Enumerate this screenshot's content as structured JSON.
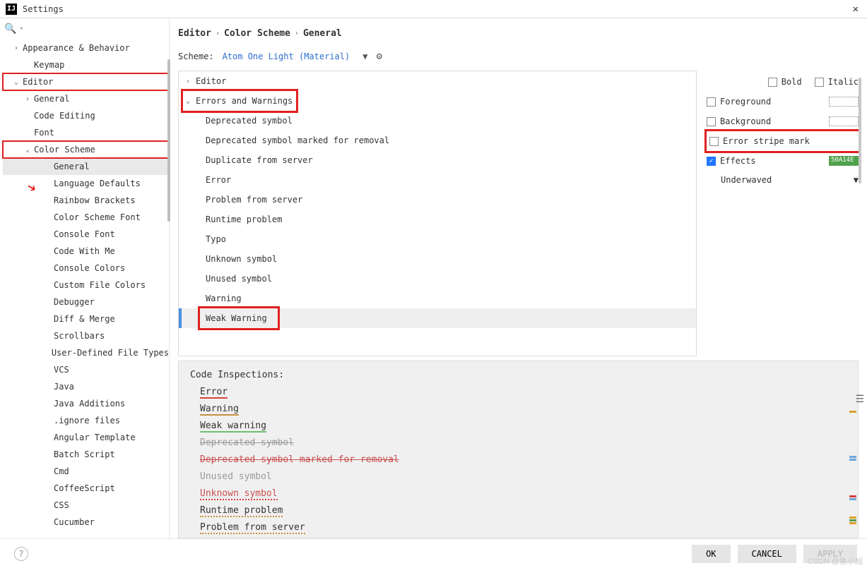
{
  "window": {
    "title": "Settings"
  },
  "sidebar": {
    "items": [
      {
        "label": "Appearance & Behavior",
        "level": 1,
        "arrow": ">"
      },
      {
        "label": "Keymap",
        "level": 2,
        "arrow": ""
      },
      {
        "label": "Editor",
        "level": 1,
        "arrow": "v",
        "redbox": true
      },
      {
        "label": "General",
        "level": 2,
        "arrow": ">"
      },
      {
        "label": "Code Editing",
        "level": 2,
        "arrow": ""
      },
      {
        "label": "Font",
        "level": 2,
        "arrow": ""
      },
      {
        "label": "Color Scheme",
        "level": 2,
        "arrow": "v",
        "redbox": true
      },
      {
        "label": "General",
        "level": 4,
        "arrow": "",
        "selected": true
      },
      {
        "label": "Language Defaults",
        "level": 4,
        "arrow": ""
      },
      {
        "label": "Rainbow Brackets",
        "level": 4,
        "arrow": ""
      },
      {
        "label": "Color Scheme Font",
        "level": 4,
        "arrow": ""
      },
      {
        "label": "Console Font",
        "level": 4,
        "arrow": ""
      },
      {
        "label": "Code With Me",
        "level": 4,
        "arrow": ""
      },
      {
        "label": "Console Colors",
        "level": 4,
        "arrow": ""
      },
      {
        "label": "Custom File Colors",
        "level": 4,
        "arrow": ""
      },
      {
        "label": "Debugger",
        "level": 4,
        "arrow": ""
      },
      {
        "label": "Diff & Merge",
        "level": 4,
        "arrow": ""
      },
      {
        "label": "Scrollbars",
        "level": 4,
        "arrow": ""
      },
      {
        "label": "User-Defined File Types",
        "level": 4,
        "arrow": ""
      },
      {
        "label": "VCS",
        "level": 4,
        "arrow": ""
      },
      {
        "label": "Java",
        "level": 4,
        "arrow": ""
      },
      {
        "label": "Java Additions",
        "level": 4,
        "arrow": ""
      },
      {
        "label": ".ignore files",
        "level": 4,
        "arrow": ""
      },
      {
        "label": "Angular Template",
        "level": 4,
        "arrow": ""
      },
      {
        "label": "Batch Script",
        "level": 4,
        "arrow": ""
      },
      {
        "label": "Cmd",
        "level": 4,
        "arrow": ""
      },
      {
        "label": "CoffeeScript",
        "level": 4,
        "arrow": ""
      },
      {
        "label": "CSS",
        "level": 4,
        "arrow": ""
      },
      {
        "label": "Cucumber",
        "level": 4,
        "arrow": ""
      }
    ]
  },
  "breadcrumb": {
    "a": "Editor",
    "b": "Color Scheme",
    "c": "General"
  },
  "scheme": {
    "label": "Scheme:",
    "value": "Atom One Light (Material)"
  },
  "tree_panel": {
    "items": [
      {
        "label": "Editor",
        "level": 1,
        "arrow": ">"
      },
      {
        "label": "Errors and Warnings",
        "level": 1,
        "arrow": "v",
        "redbox": true
      },
      {
        "label": "Deprecated symbol",
        "level": 2
      },
      {
        "label": "Deprecated symbol marked for removal",
        "level": 2
      },
      {
        "label": "Duplicate from server",
        "level": 2
      },
      {
        "label": "Error",
        "level": 2
      },
      {
        "label": "Problem from server",
        "level": 2
      },
      {
        "label": "Runtime problem",
        "level": 2
      },
      {
        "label": "Typo",
        "level": 2
      },
      {
        "label": "Unknown symbol",
        "level": 2
      },
      {
        "label": "Unused symbol",
        "level": 2
      },
      {
        "label": "Warning",
        "level": 2
      },
      {
        "label": "Weak Warning",
        "level": 2,
        "selected": true,
        "redbox": true
      }
    ]
  },
  "attrs": {
    "bold": "Bold",
    "italic": "Italic",
    "foreground": "Foreground",
    "background": "Background",
    "error_stripe": "Error stripe mark",
    "effects": "Effects",
    "effects_type": "Underwaved",
    "effects_color": "#50A14E"
  },
  "preview": {
    "header": "Code Inspections:",
    "lines": [
      {
        "text": "Error",
        "cls": "ul-red"
      },
      {
        "text": "Warning",
        "cls": "ul-org"
      },
      {
        "text": "Weak warning",
        "cls": "ul-grn"
      },
      {
        "text": "Deprecated symbol",
        "cls": "strike"
      },
      {
        "text": "Deprecated symbol marked for removal",
        "cls": "strike",
        "color": "#c94f4f"
      },
      {
        "text": "Unused symbol",
        "cls": "",
        "muted": true
      },
      {
        "text": "Unknown symbol",
        "cls": "ul-dotted",
        "color": "#c94f4f"
      },
      {
        "text": "Runtime problem",
        "cls": "ul-dot-org"
      },
      {
        "text": "Problem from server",
        "cls": "ul-dot-org"
      }
    ]
  },
  "footer": {
    "ok": "OK",
    "cancel": "CANCEL",
    "apply": "APPLY"
  },
  "watermark": "CSDN @鱼小旭"
}
